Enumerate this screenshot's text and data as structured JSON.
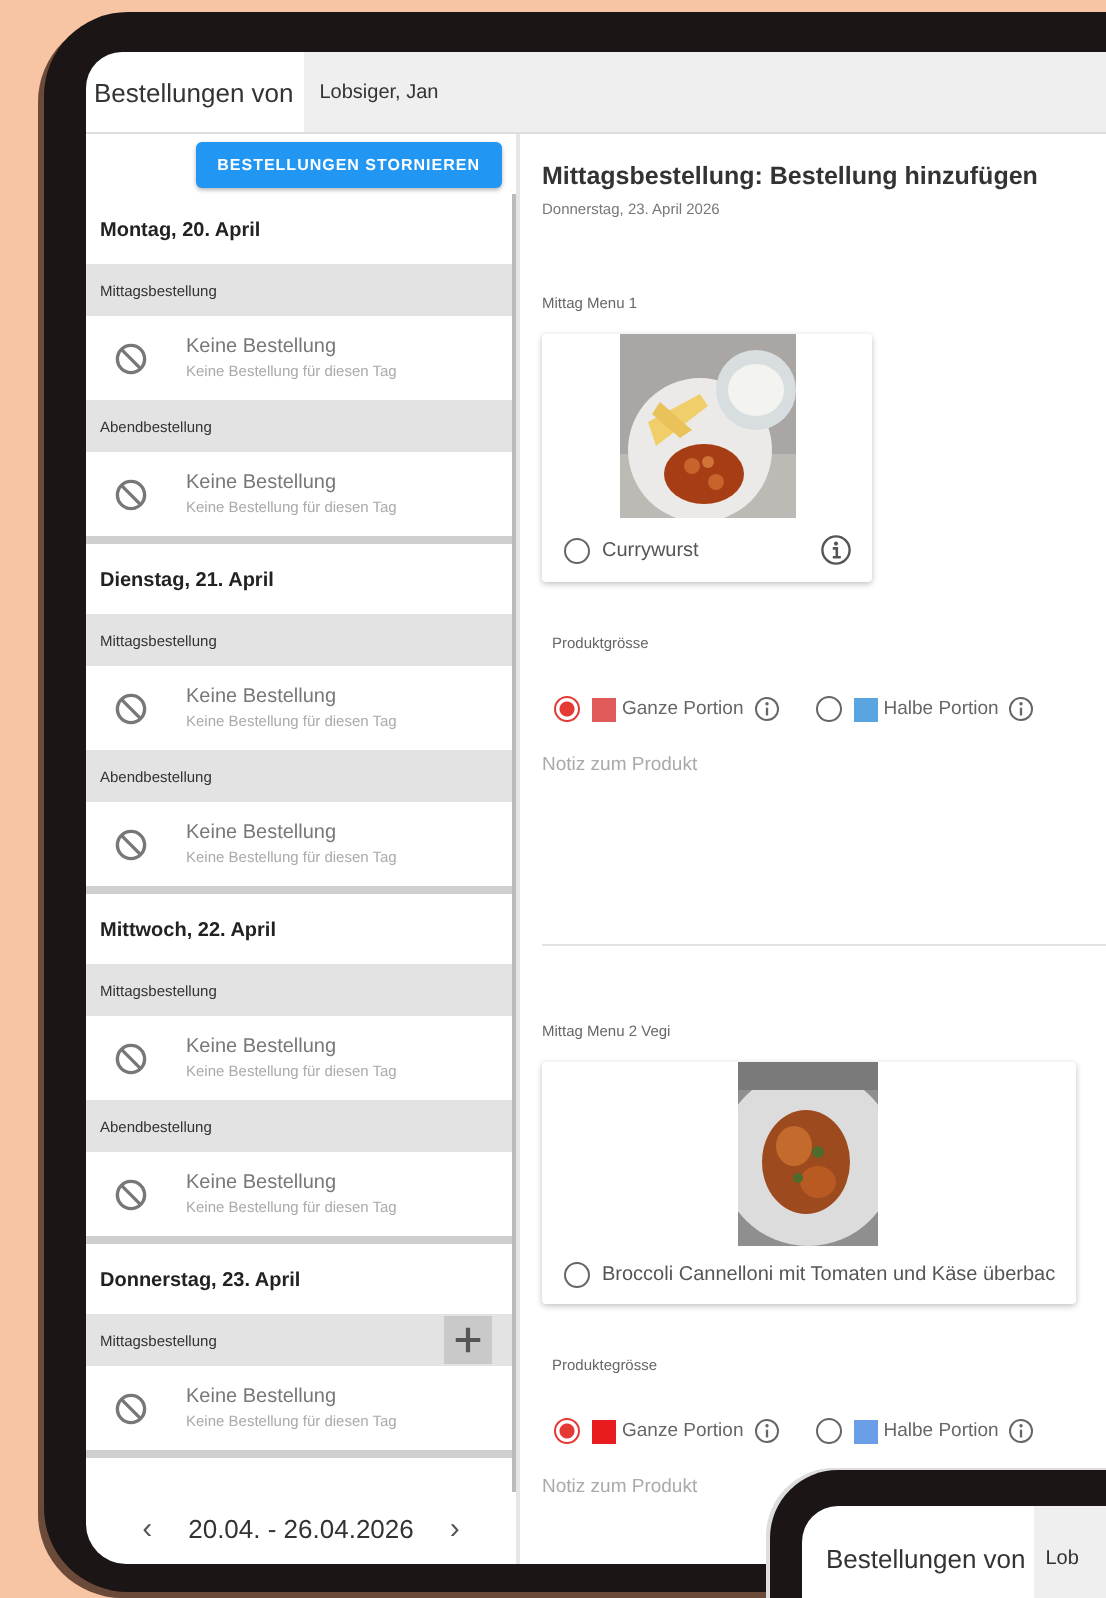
{
  "header": {
    "title": "Bestellungen von",
    "user": "Lobsiger, Jan"
  },
  "cancel_button": "BESTELLUNGEN STORNIEREN",
  "days": [
    {
      "date": "Montag, 20. April",
      "meals": [
        {
          "label": "Mittagsbestellung",
          "can_add": false,
          "status": "Keine Bestellung",
          "detail": "Keine Bestellung für diesen Tag"
        },
        {
          "label": "Abendbestellung",
          "can_add": false,
          "status": "Keine Bestellung",
          "detail": "Keine Bestellung für diesen Tag"
        }
      ]
    },
    {
      "date": "Dienstag, 21. April",
      "meals": [
        {
          "label": "Mittagsbestellung",
          "can_add": false,
          "status": "Keine Bestellung",
          "detail": "Keine Bestellung für diesen Tag"
        },
        {
          "label": "Abendbestellung",
          "can_add": false,
          "status": "Keine Bestellung",
          "detail": "Keine Bestellung für diesen Tag"
        }
      ]
    },
    {
      "date": "Mittwoch, 22. April",
      "meals": [
        {
          "label": "Mittagsbestellung",
          "can_add": false,
          "status": "Keine Bestellung",
          "detail": "Keine Bestellung für diesen Tag"
        },
        {
          "label": "Abendbestellung",
          "can_add": false,
          "status": "Keine Bestellung",
          "detail": "Keine Bestellung für diesen Tag"
        }
      ]
    },
    {
      "date": "Donnerstag, 23. April",
      "meals": [
        {
          "label": "Mittagsbestellung",
          "can_add": true,
          "status": "Keine Bestellung",
          "detail": "Keine Bestellung für diesen Tag"
        }
      ]
    }
  ],
  "week_nav": {
    "prev": "‹",
    "range": "20.04. - 26.04.2026",
    "next": "›"
  },
  "form": {
    "title": "Mittagsbestellung: Bestellung hinzufügen",
    "date": "Donnerstag, 23. April 2026",
    "menus": [
      {
        "category": "Mittag Menu 1",
        "name": "Currywurst",
        "selected": false,
        "info": true,
        "size_label": "Produktgrösse",
        "sizes": [
          {
            "label": "Ganze Portion",
            "color": "#e05a5a",
            "selected": true
          },
          {
            "label": "Halbe Portion",
            "color": "#5aa5e0",
            "selected": false
          }
        ],
        "note_placeholder": "Notiz zum Produkt"
      },
      {
        "category": "Mittag Menu 2 Vegi",
        "name": "Broccoli Cannelloni mit Tomaten und Käse überbac",
        "selected": false,
        "info": false,
        "size_label": "Produktegrösse",
        "sizes": [
          {
            "label": "Ganze Portion",
            "color": "#e81c1c",
            "selected": true
          },
          {
            "label": "Halbe Portion",
            "color": "#6a9ee6",
            "selected": false
          }
        ],
        "note_placeholder": "Notiz zum Produkt"
      }
    ]
  },
  "second_device": {
    "title": "Bestellungen von",
    "user": "Lob"
  }
}
